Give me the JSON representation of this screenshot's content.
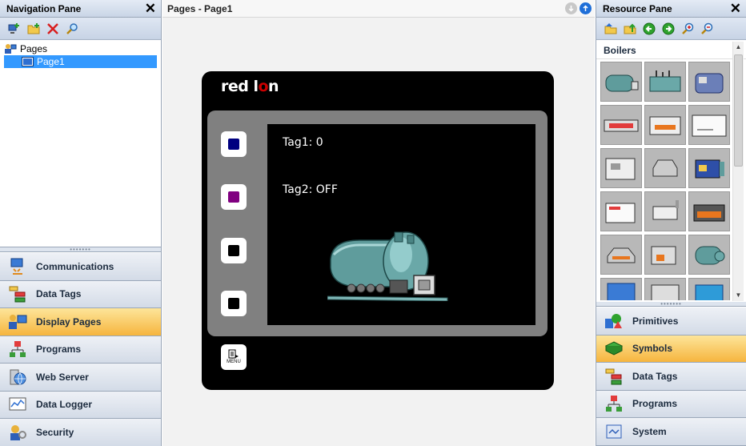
{
  "nav_pane": {
    "title": "Navigation Pane",
    "tree": {
      "root_label": "Pages",
      "children": [
        "Page1"
      ]
    },
    "sections": [
      {
        "label": "Communications",
        "icon": "communications-icon"
      },
      {
        "label": "Data Tags",
        "icon": "data-tags-icon"
      },
      {
        "label": "Display Pages",
        "icon": "display-pages-icon",
        "active": true
      },
      {
        "label": "Programs",
        "icon": "programs-icon"
      },
      {
        "label": "Web Server",
        "icon": "web-server-icon"
      },
      {
        "label": "Data Logger",
        "icon": "data-logger-icon"
      },
      {
        "label": "Security",
        "icon": "security-icon"
      }
    ]
  },
  "center": {
    "title": "Pages - Page1",
    "device": {
      "brand_left": "red l",
      "brand_right": "n",
      "tag1": "Tag1:  0",
      "tag2": "Tag2:  OFF",
      "menu_label": "MENU",
      "key_colors": [
        "#000080",
        "#800080",
        "#000000",
        "#000000"
      ]
    }
  },
  "res_pane": {
    "title": "Resource Pane",
    "category": "Boilers",
    "sections": [
      {
        "label": "Primitives",
        "icon": "primitives-icon"
      },
      {
        "label": "Symbols",
        "icon": "symbols-icon",
        "active": true
      },
      {
        "label": "Data Tags",
        "icon": "data-tags-icon"
      },
      {
        "label": "Programs",
        "icon": "programs-icon"
      },
      {
        "label": "System",
        "icon": "system-icon"
      }
    ]
  },
  "colors": {
    "accent_active": "#f6b53e",
    "selection": "#3399ff",
    "pane_header": "#c9d5e6"
  }
}
